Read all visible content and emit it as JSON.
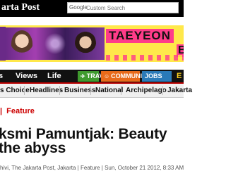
{
  "header": {
    "logo_text": "arta Post",
    "search": {
      "brand": "Google",
      "placeholder": "Custom Search"
    }
  },
  "banner": {
    "name_primary": "TAEYEON",
    "name_secondary": "BAEK",
    "accent_color": "#ff3c8a",
    "background_color": "#ffe84a"
  },
  "nav": {
    "items": [
      {
        "label": "s"
      },
      {
        "label": "Views"
      },
      {
        "label": "Life"
      }
    ],
    "buttons": [
      {
        "label": "TRAVEL",
        "icon": "plane-icon",
        "color": "#3f9a2e"
      },
      {
        "label": "COMMUNITY",
        "icon": "people-icon",
        "color": "#e86a1a"
      },
      {
        "label": "JOBS",
        "icon": "",
        "color": "#2a7ab8"
      }
    ],
    "trailing": "E"
  },
  "subnav": {
    "items": [
      {
        "label": "s Choice"
      },
      {
        "label": "Headlines"
      },
      {
        "label": "Business"
      },
      {
        "label": "National"
      },
      {
        "label": "Archipelago"
      },
      {
        "label": "Jakarta"
      }
    ]
  },
  "breadcrumb": {
    "separator": "|",
    "section": "Feature"
  },
  "article": {
    "title_line1": "ksmi Pamuntjak: Beauty",
    "title_line2": "the abyss",
    "byline": "hivi, The Jakarta Post, Jakarta | Feature | Sun, October 21 2012, 8:33 AM"
  }
}
